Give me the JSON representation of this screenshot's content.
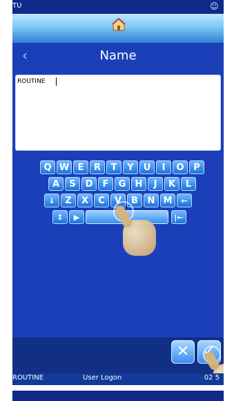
{
  "topbar": {
    "left_text": "TU",
    "right_icon": "user-icon"
  },
  "header": {
    "home_icon": "home-icon"
  },
  "titlebar": {
    "back_icon": "chevron-left-icon",
    "title": "Name"
  },
  "input": {
    "value": "ROUTINE"
  },
  "keyboard": {
    "row1": [
      "Q",
      "W",
      "E",
      "R",
      "T",
      "Y",
      "U",
      "I",
      "O",
      "P"
    ],
    "row2": [
      "A",
      "S",
      "D",
      "F",
      "G",
      "H",
      "J",
      "K",
      "L"
    ],
    "row3": [
      "↓",
      "Z",
      "X",
      "C",
      "V",
      "B",
      "N",
      "M",
      "←"
    ],
    "row4_left": [
      "↕",
      "▶"
    ],
    "row4_right": [
      "|←"
    ]
  },
  "actions": {
    "cancel_icon": "close-icon",
    "ok_icon": "check-icon"
  },
  "status": {
    "left": "ROUTINE",
    "middle": "User Logon",
    "right": "02 5"
  },
  "colors": {
    "bg": "#1a3fb8",
    "key": "#1c73dd",
    "header": "#7cc9f3"
  }
}
